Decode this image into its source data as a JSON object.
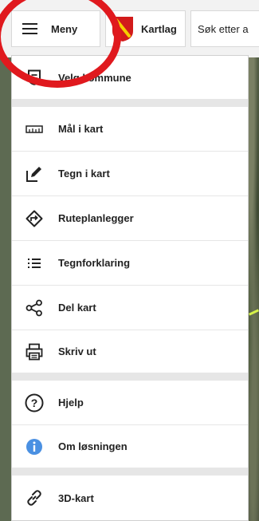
{
  "toolbar": {
    "menu_label": "Meny",
    "layers_label": "Kartlag",
    "search_placeholder": "Søk etter a"
  },
  "menu": {
    "select_municipality": "Velg kommune",
    "measure": "Mål i kart",
    "draw": "Tegn i kart",
    "route_planner": "Ruteplanlegger",
    "legend": "Tegnforklaring",
    "share": "Del kart",
    "print": "Skriv ut",
    "help": "Hjelp",
    "about": "Om løsningen",
    "map3d": "3D-kart"
  },
  "colors": {
    "annotation_circle": "#e0191e",
    "info_icon": "#4a90e2",
    "flag_red": "#d21b1b",
    "flag_yellow": "#f5d000"
  },
  "icons": {
    "menu": "hamburger-icon",
    "layers": "coat-of-arms-icon",
    "select_municipality": "shield-icon",
    "measure": "ruler-icon",
    "draw": "pencil-square-icon",
    "route_planner": "route-diamond-icon",
    "legend": "list-icon",
    "share": "share-icon",
    "print": "printer-icon",
    "help": "question-circle-icon",
    "about": "info-circle-icon",
    "map3d": "link-icon"
  }
}
